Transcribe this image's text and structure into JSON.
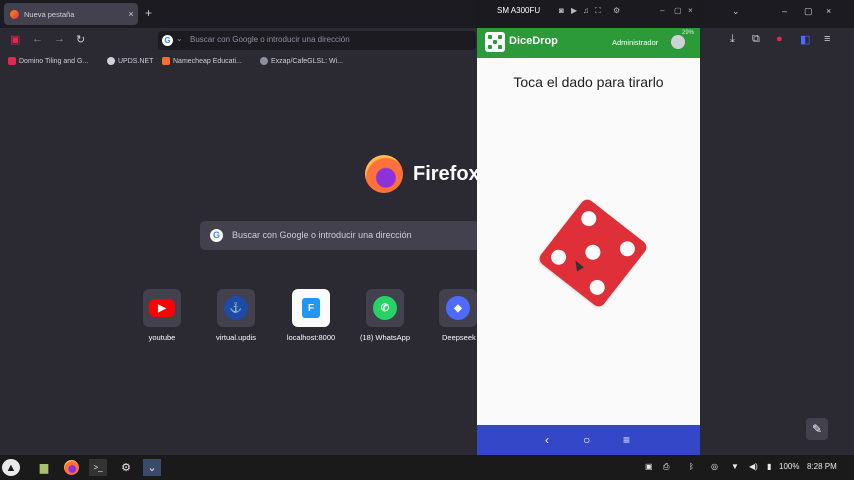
{
  "browser": {
    "tab_title": "Nueva pestaña",
    "tab_close": "×",
    "new_tab": "+",
    "controls": {
      "list": "⌄",
      "minimize": "–",
      "maximize": "▢",
      "close": "×"
    },
    "url_placeholder": "Buscar con Google o introducir una dirección",
    "bookmarks": [
      {
        "label": "Domino Tiling and G...",
        "color": "#e22850"
      },
      {
        "label": "UPDS.NET",
        "color": "#d0d0d8"
      },
      {
        "label": "Namecheap Educati...",
        "color": "#ff6c2c"
      },
      {
        "label": "Exzap/CafeGLSL: Wi...",
        "color": "#8f8f9d"
      }
    ]
  },
  "newtab": {
    "brand": "Firefox",
    "search_placeholder": "Buscar con Google o introducir una dirección",
    "shortcuts": [
      {
        "label": "youtube",
        "icon": "youtube-icon",
        "color": "#ff0000",
        "glyph": "▶"
      },
      {
        "label": "virtual.updis",
        "icon": "updis-icon",
        "color": "#1f4ba8",
        "glyph": "⚓"
      },
      {
        "label": "localhost:8000",
        "icon": "flutter-icon",
        "color": "#2196f3",
        "glyph": "F"
      },
      {
        "label": "(18) WhatsApp",
        "icon": "whatsapp-icon",
        "color": "#25d366",
        "glyph": "✆"
      },
      {
        "label": "Deepseek",
        "icon": "deepseek-icon",
        "color": "#4d6bfe",
        "glyph": "🐋"
      }
    ]
  },
  "phone": {
    "device_name": "SM A300FU",
    "app_title": "DiceDrop",
    "status": "29%",
    "user": "Administrador",
    "prompt": "Toca el dado para tirarlo",
    "die_value": 5,
    "die_color": "#df2f38",
    "nav": {
      "back": "‹",
      "home": "○",
      "menu": "≡"
    }
  },
  "taskbar": {
    "battery": "100%",
    "clock": "8:28 PM"
  }
}
